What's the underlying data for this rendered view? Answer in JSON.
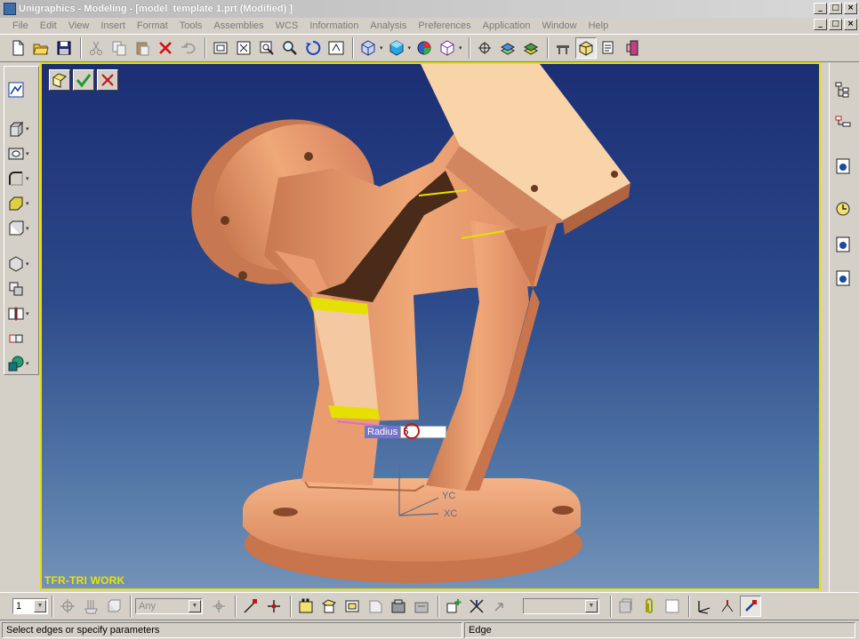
{
  "window": {
    "title": "Unigraphics - Modeling - [model_template 1.prt (Modified) ]"
  },
  "menu": [
    "File",
    "Edit",
    "View",
    "Insert",
    "Format",
    "Tools",
    "Assemblies",
    "WCS",
    "Information",
    "Analysis",
    "Preferences",
    "Application",
    "Window",
    "Help"
  ],
  "viewport": {
    "layer_label": "TFR-TRI WORK",
    "radius_label": "Radius",
    "radius_value": "5",
    "triad_y": "YC",
    "triad_x": "XC"
  },
  "bottom_toolbar": {
    "layer_select": "1",
    "filter_select": "Any",
    "snap_select": ""
  },
  "status": {
    "prompt": "Select edges or specify parameters",
    "selection": "Edge"
  },
  "colors": {
    "model": "#f0a878",
    "selection_highlight": "#e5e000",
    "viewport_top": "#1c2e74",
    "viewport_bottom": "#7392b8"
  }
}
